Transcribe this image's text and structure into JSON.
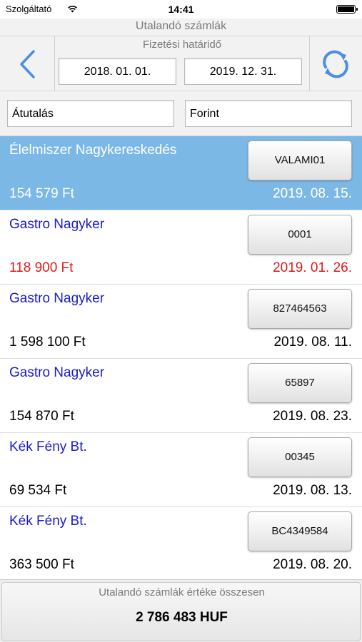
{
  "status_bar": {
    "carrier": "Szolgáltató",
    "time": "14:41"
  },
  "header": {
    "title": "Utalandó számlák",
    "deadline_label": "Fizetési határidő",
    "date_from": "2018. 01. 01.",
    "date_to": "2019. 12. 31."
  },
  "filters": {
    "payment_type": "Átutalás",
    "currency": "Forint"
  },
  "colors": {
    "accent": "#4a90e2",
    "selected_row": "#7cb8e6",
    "partner_text": "#1a1acc",
    "overdue": "#e01a1a"
  },
  "invoices": [
    {
      "partner": "Élelmiszer Nagykereskedés",
      "reference": "VALAMI01",
      "amount": "154 579 Ft",
      "due_date": "2019. 08. 15.",
      "state": "selected"
    },
    {
      "partner": "Gastro Nagyker",
      "reference": "0001",
      "amount": "118 900 Ft",
      "due_date": "2019. 01. 26.",
      "state": "overdue"
    },
    {
      "partner": "Gastro Nagyker",
      "reference": "827464563",
      "amount": "1 598 100 Ft",
      "due_date": "2019. 08. 11.",
      "state": "normal"
    },
    {
      "partner": "Gastro Nagyker",
      "reference": "65897",
      "amount": "154 870 Ft",
      "due_date": "2019. 08. 23.",
      "state": "normal"
    },
    {
      "partner": "Kék Fény Bt.",
      "reference": "00345",
      "amount": "69 534 Ft",
      "due_date": "2019. 08. 13.",
      "state": "normal"
    },
    {
      "partner": "Kék Fény Bt.",
      "reference": "BC4349584",
      "amount": "363 500 Ft",
      "due_date": "2019. 08. 20.",
      "state": "normal"
    }
  ],
  "footer": {
    "label": "Utalandó számlák értéke összesen",
    "total": "2 786 483 HUF"
  }
}
